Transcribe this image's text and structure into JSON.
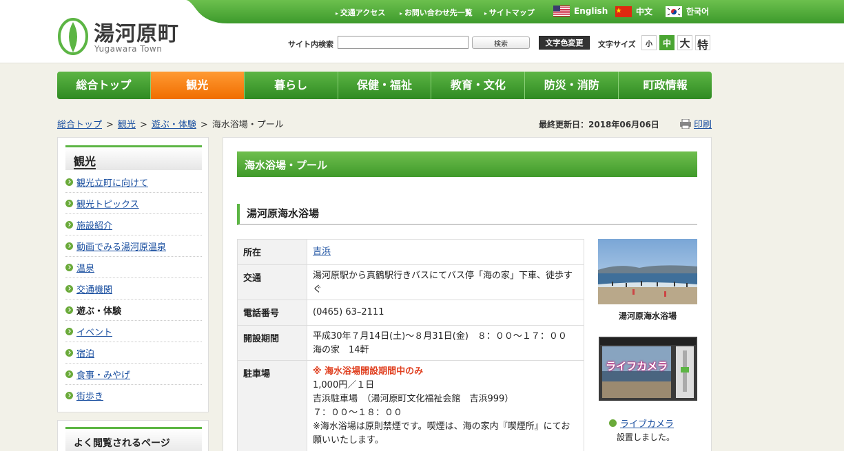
{
  "header": {
    "logo_ja": "湯河原町",
    "logo_en": "Yugawara Town",
    "links": [
      "交通アクセス",
      "お問い合わせ先一覧",
      "サイトマップ"
    ],
    "languages": [
      {
        "label": "English",
        "flag": "us-flag-icon"
      },
      {
        "label": "中文",
        "flag": "china-flag-icon"
      },
      {
        "label": "한국어",
        "flag": "korea-flag-icon"
      }
    ],
    "search_label": "サイト内検索",
    "search_value": "",
    "search_button": "検索",
    "color_button": "文字色変更",
    "fontsize_label": "文字サイズ",
    "fontsizes": [
      "小",
      "中",
      "大",
      "特"
    ],
    "brand_green": "#5cb544"
  },
  "nav": {
    "items": [
      "総合トップ",
      "観光",
      "暮らし",
      "保健・福祉",
      "教育・文化",
      "防災・消防",
      "町政情報"
    ],
    "active_index": 1,
    "active_color": "#f07d10"
  },
  "breadcrumb": {
    "items": [
      "総合トップ",
      "観光",
      "遊ぶ・体験"
    ],
    "current": "海水浴場・プール"
  },
  "updated": "最終更新日：2018年06月06日",
  "print_label": "印刷",
  "sidebar": {
    "title": "観光",
    "items": [
      "観光立町に向けて",
      "観光トピックス",
      "施設紹介",
      "動画でみる湯河原温泉",
      "温泉",
      "交通機関",
      "遊ぶ・体験",
      "イベント",
      "宿泊",
      "食事・みやげ",
      "街歩き"
    ],
    "current_index": 6,
    "title2": "よく閲覧されるページ"
  },
  "main": {
    "page_title": "海水浴場・プール",
    "section_title": "湯河原海水浴場",
    "table": {
      "location_label": "所在",
      "location_value": "吉浜",
      "transport_label": "交通",
      "transport_value": "湯河原駅から真鶴駅行きバスにてバス停「海の家」下車、徒歩すぐ",
      "phone_label": "電話番号",
      "phone_value": "(0465) 63–2111",
      "period_label": "開設期間",
      "period_line1": "平成30年７月14日(土)〜８月31日(金)　８：００〜１７：００",
      "period_line2": "海の家　14軒",
      "parking_label": "駐車場",
      "parking_warn": "※ 海水浴場開設期間中のみ",
      "parking_line1": "1,000円／１日",
      "parking_line2": "吉浜駐車場　（湯河原町文化福祉会館　吉浜999）",
      "parking_line3": "７：００〜１８：００",
      "parking_line4": "※海水浴場は原則禁煙です。喫煙は、海の家内『喫煙所』にてお願いいたします。"
    },
    "photo_caption": "湯河原海水浴場",
    "livecam_overlay": "ライフカメラ",
    "livecam_link": "ライブカメラ",
    "livecam_note": "設置しました。"
  }
}
